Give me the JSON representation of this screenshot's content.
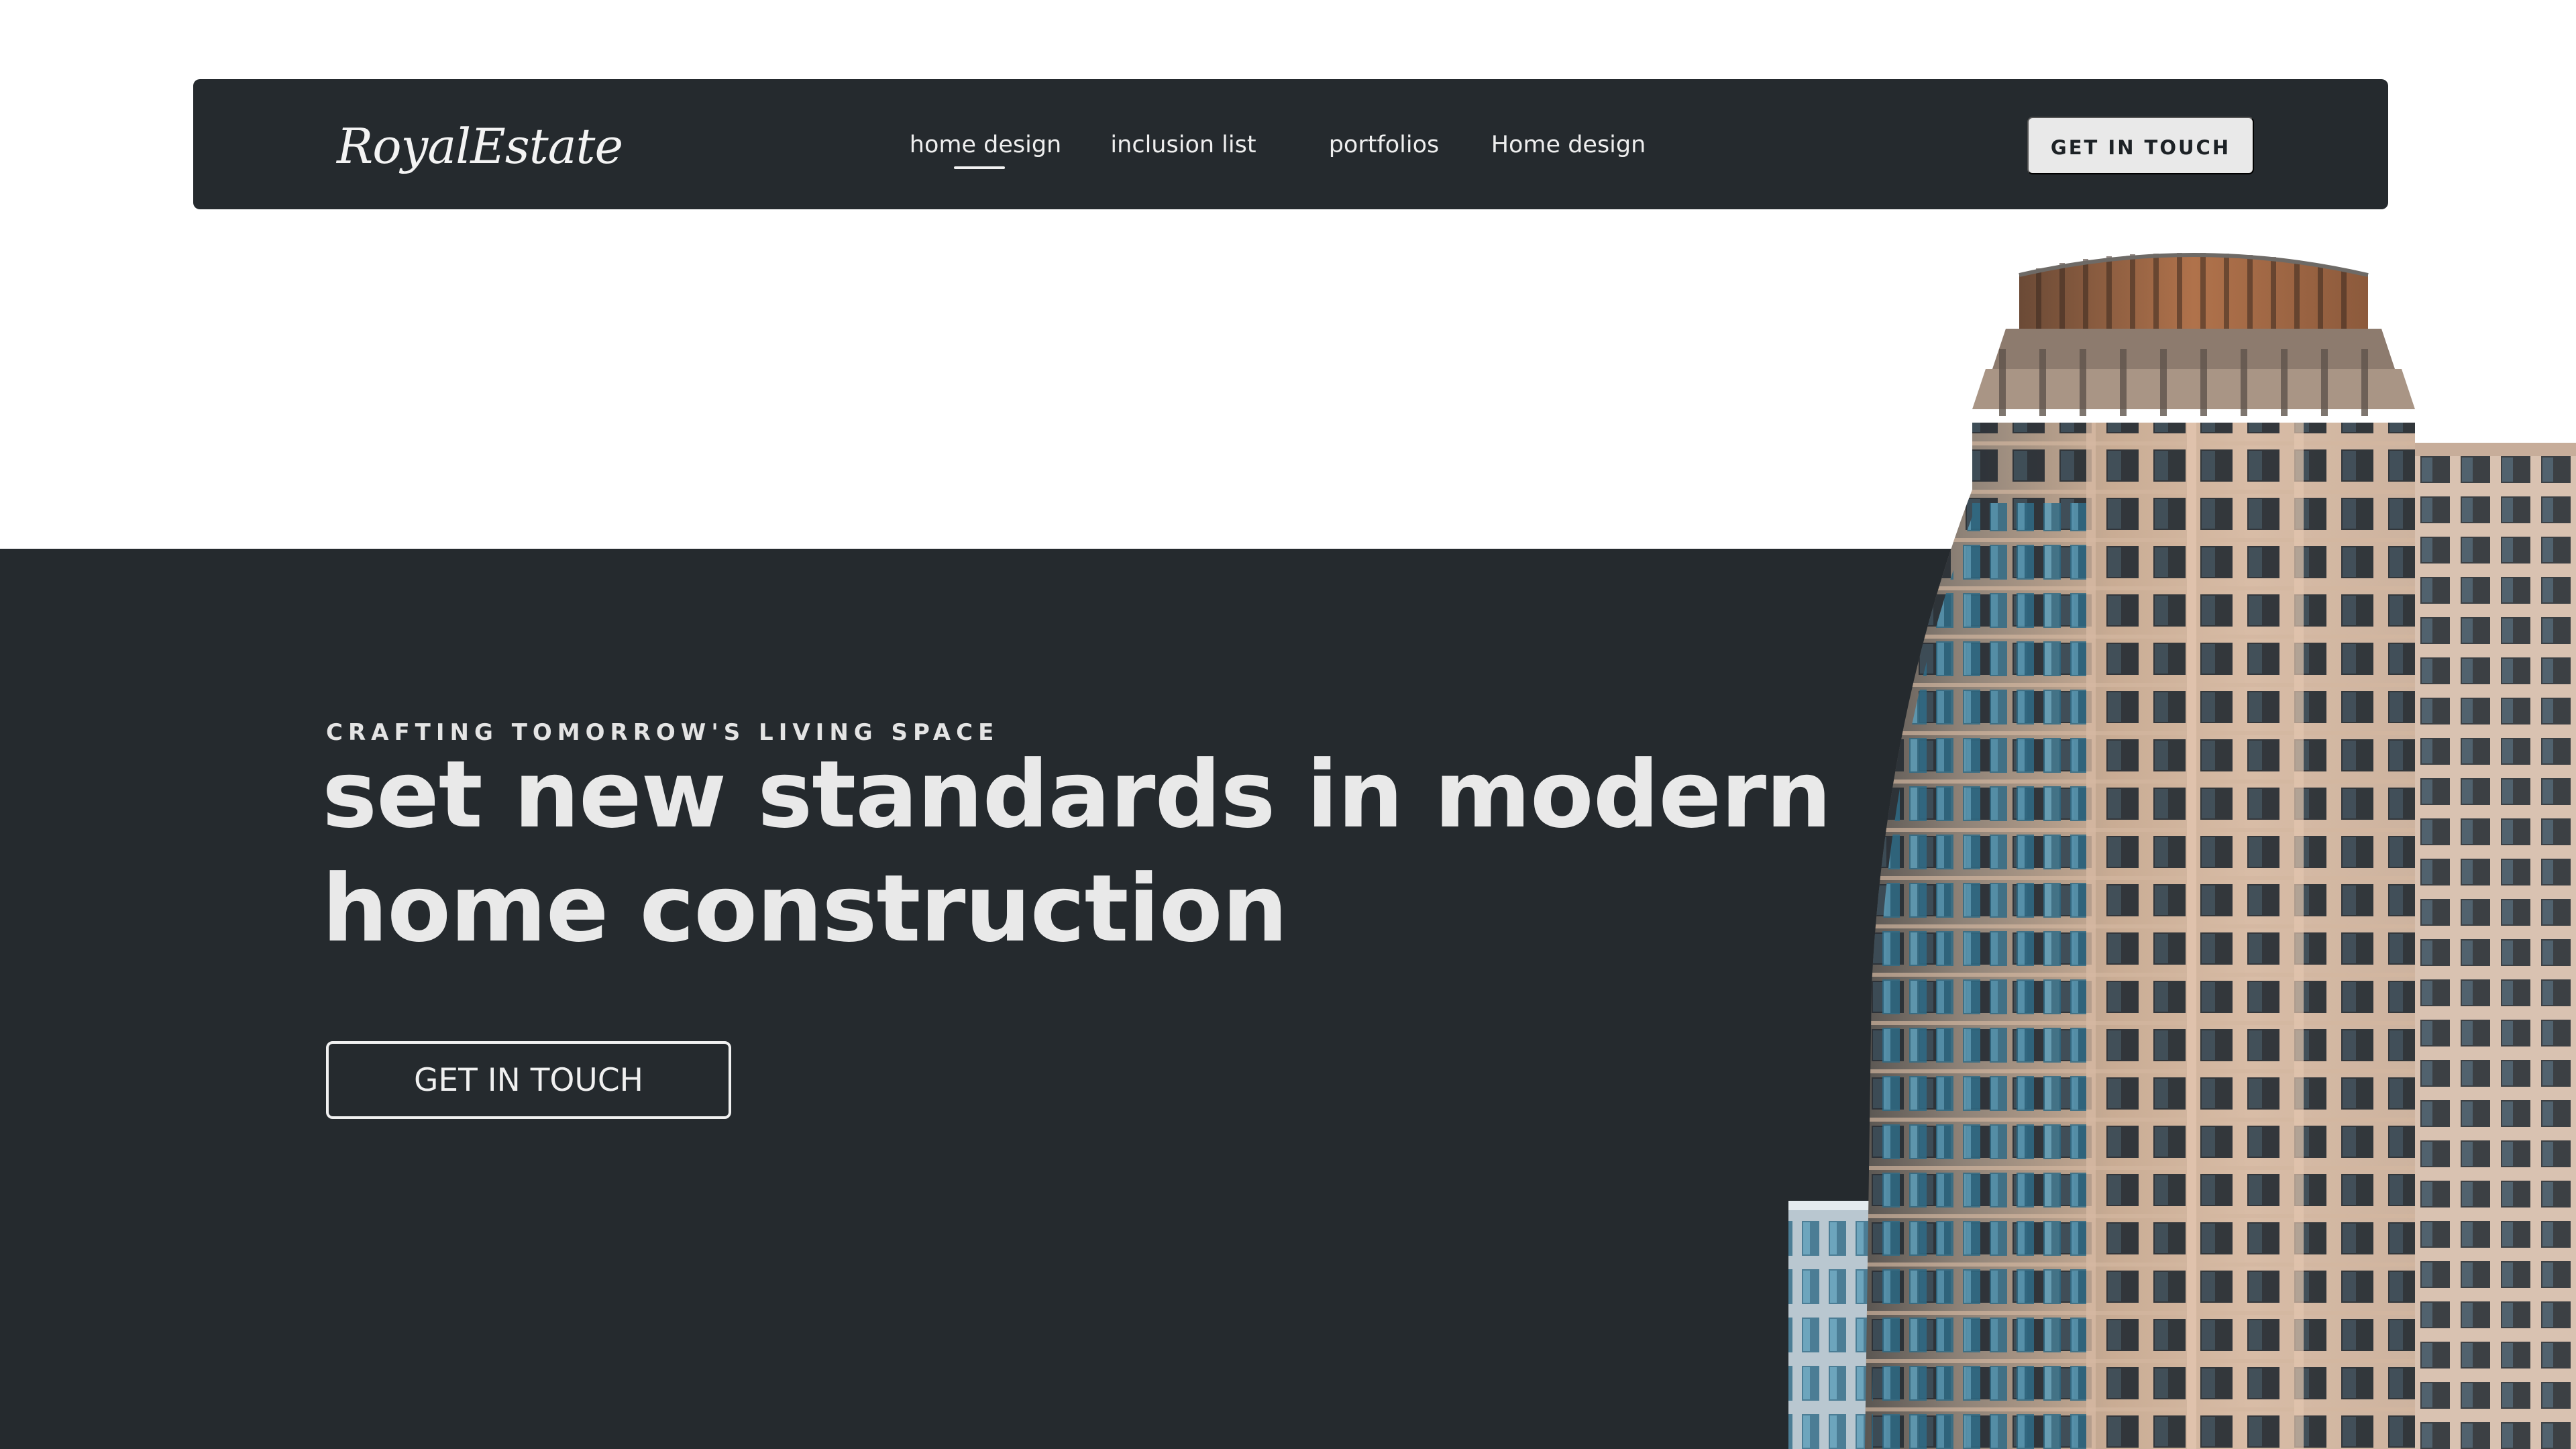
{
  "brand": {
    "logo_text": "RoyalEstate"
  },
  "nav": {
    "items": [
      {
        "label": "home design",
        "active": true
      },
      {
        "label": "inclusion list",
        "active": false
      },
      {
        "label": "portfolios",
        "active": false
      },
      {
        "label": "Home design",
        "active": false
      }
    ],
    "cta_label": "GET IN TOUCH"
  },
  "hero": {
    "eyebrow": "CRAFTING TOMORROW'S LIVING SPACE",
    "headline_line1": "set new standards in modern",
    "headline_line2": "home construction",
    "cta_label": "GET IN TOUCH",
    "image_subject": "building-photo"
  },
  "colors": {
    "dark_background": "#252a2e",
    "text_light": "#e9e9e9",
    "nav_cta_background": "#e9e9e9",
    "page_background": "#ffffff"
  }
}
